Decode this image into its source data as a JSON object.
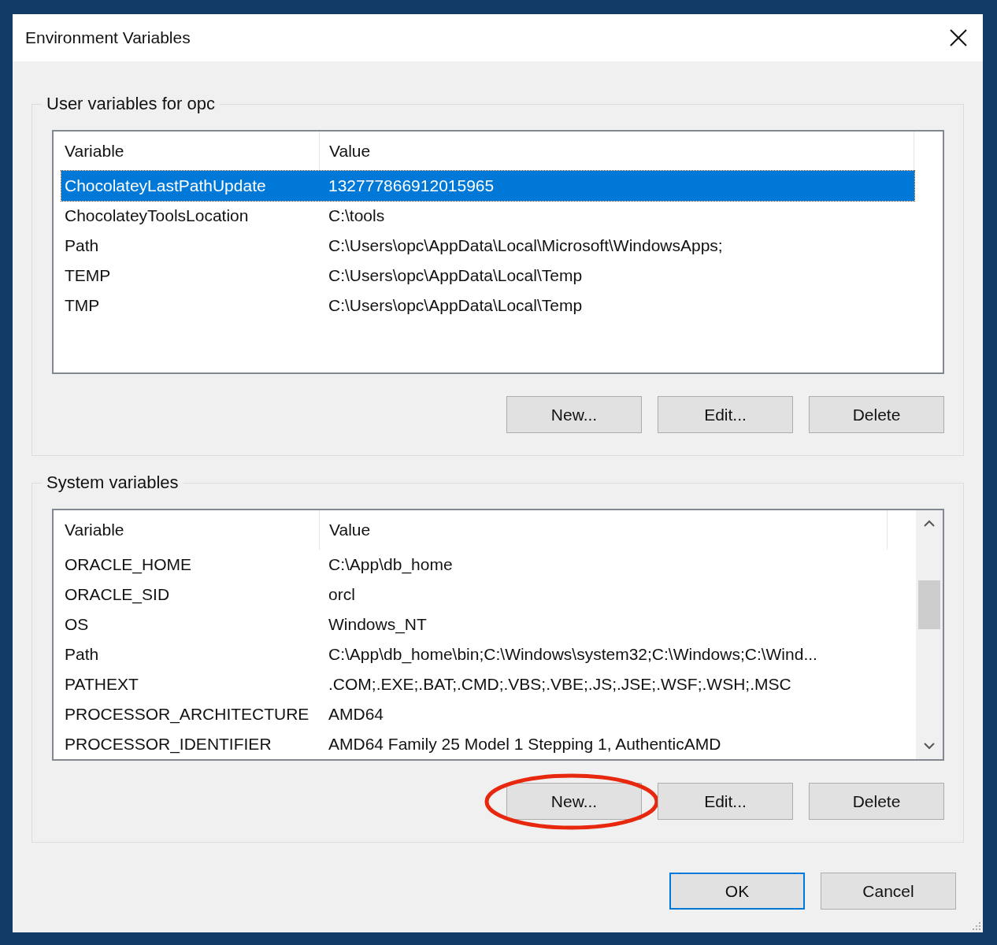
{
  "window": {
    "title": "Environment Variables"
  },
  "sections": [
    {
      "title": "User variables for opc",
      "columns": [
        "Variable",
        "Value"
      ],
      "scrollable": false,
      "rows": [
        {
          "cells": [
            "ChocolateyLastPathUpdate",
            "132777866912015965"
          ],
          "selected": true
        },
        {
          "cells": [
            "ChocolateyToolsLocation",
            "C:\\tools"
          ],
          "selected": false
        },
        {
          "cells": [
            "Path",
            "C:\\Users\\opc\\AppData\\Local\\Microsoft\\WindowsApps;"
          ],
          "selected": false
        },
        {
          "cells": [
            "TEMP",
            "C:\\Users\\opc\\AppData\\Local\\Temp"
          ],
          "selected": false
        },
        {
          "cells": [
            "TMP",
            "C:\\Users\\opc\\AppData\\Local\\Temp"
          ],
          "selected": false
        }
      ],
      "buttons": [
        {
          "label": "New...",
          "highlighted": false
        },
        {
          "label": "Edit...",
          "highlighted": false
        },
        {
          "label": "Delete",
          "highlighted": false
        }
      ]
    },
    {
      "title": "System variables",
      "columns": [
        "Variable",
        "Value"
      ],
      "scrollable": true,
      "rows": [
        {
          "cells": [
            "ORACLE_HOME",
            "C:\\App\\db_home"
          ],
          "selected": false
        },
        {
          "cells": [
            "ORACLE_SID",
            "orcl"
          ],
          "selected": false
        },
        {
          "cells": [
            "OS",
            "Windows_NT"
          ],
          "selected": false
        },
        {
          "cells": [
            "Path",
            "C:\\App\\db_home\\bin;C:\\Windows\\system32;C:\\Windows;C:\\Wind..."
          ],
          "selected": false
        },
        {
          "cells": [
            "PATHEXT",
            ".COM;.EXE;.BAT;.CMD;.VBS;.VBE;.JS;.JSE;.WSF;.WSH;.MSC"
          ],
          "selected": false
        },
        {
          "cells": [
            "PROCESSOR_ARCHITECTURE",
            "AMD64"
          ],
          "selected": false
        },
        {
          "cells": [
            "PROCESSOR_IDENTIFIER",
            "AMD64 Family 25 Model 1 Stepping 1, AuthenticAMD"
          ],
          "selected": false
        }
      ],
      "buttons": [
        {
          "label": "New...",
          "highlighted": true
        },
        {
          "label": "Edit...",
          "highlighted": false
        },
        {
          "label": "Delete",
          "highlighted": false
        }
      ]
    }
  ],
  "dialog_buttons": [
    {
      "label": "OK",
      "default": true
    },
    {
      "label": "Cancel",
      "default": false
    }
  ]
}
